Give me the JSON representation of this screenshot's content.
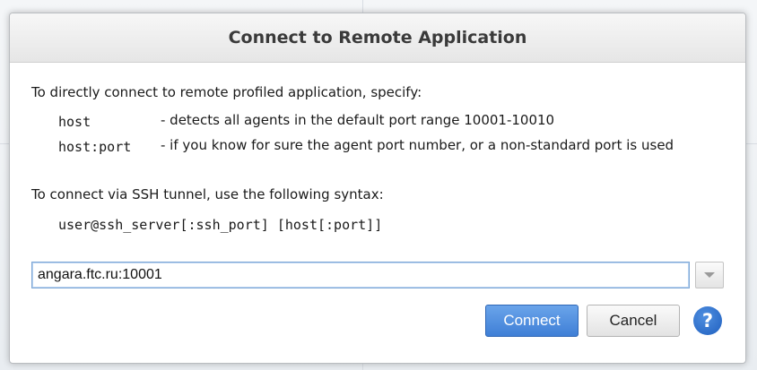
{
  "dialog": {
    "title": "Connect to Remote Application"
  },
  "instructions": {
    "intro": "To directly connect to remote profiled application, specify:",
    "options": [
      {
        "syntax": "host",
        "description": "- detects all agents in the default port range 10001-10010"
      },
      {
        "syntax": "host:port",
        "description": "- if you know for sure the agent port number, or a non-standard port is used"
      }
    ],
    "ssh_intro": "To connect via SSH tunnel, use the following syntax:",
    "ssh_syntax": "user@ssh_server[:ssh_port] [host[:port]]"
  },
  "address": {
    "value": "angara.ftc.ru:10001",
    "dropdown_icon": "chevron-down-icon"
  },
  "buttons": {
    "connect_label": "Connect",
    "cancel_label": "Cancel",
    "help_glyph": "?"
  },
  "colors": {
    "primary_button": "#3f7fd6",
    "help_icon": "#1f5fbf",
    "focus_border": "#7ea7d6"
  }
}
